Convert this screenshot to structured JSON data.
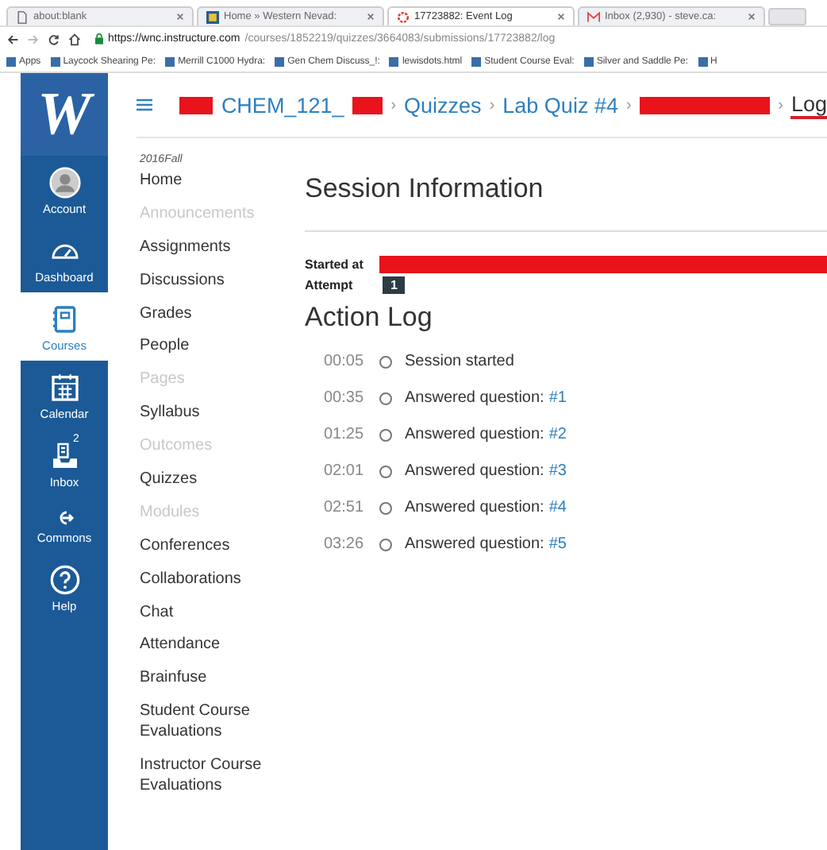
{
  "browser": {
    "tabs": [
      {
        "title": "about:blank",
        "selected": false
      },
      {
        "title": "Home » Western Nevad:",
        "selected": false
      },
      {
        "title": "17723882: Event Log",
        "selected": true
      },
      {
        "title": "Inbox (2,930) - steve.ca:",
        "selected": false
      }
    ],
    "url_host": "https://wnc.instructure.com",
    "url_path": "/courses/1852219/quizzes/3664083/submissions/17723882/log",
    "bookmarks": [
      "Apps",
      "Laycock Shearing Pe:",
      "Merrill C1000 Hydra:",
      "Gen Chem Discuss_!:",
      "lewisdots.html",
      "Student Course Eval:",
      "Silver and Saddle Pe:",
      "H"
    ]
  },
  "logo": "W",
  "global_nav": [
    {
      "label": "Account",
      "selected": false
    },
    {
      "label": "Dashboard",
      "selected": false
    },
    {
      "label": "Courses",
      "selected": true
    },
    {
      "label": "Calendar",
      "selected": false
    },
    {
      "label": "Inbox",
      "selected": false,
      "badge": "2"
    },
    {
      "label": "Commons",
      "selected": false
    },
    {
      "label": "Help",
      "selected": false
    }
  ],
  "breadcrumbs": [
    {
      "kind": "redacted"
    },
    {
      "kind": "text",
      "text": "CHEM_121_"
    },
    {
      "kind": "redacted"
    },
    {
      "kind": "sep",
      "text": "›"
    },
    {
      "kind": "link",
      "text": "Quizzes"
    },
    {
      "kind": "sep",
      "text": "›"
    },
    {
      "kind": "link",
      "text": "Lab Quiz #4"
    },
    {
      "kind": "sep",
      "text": "›"
    },
    {
      "kind": "redacted"
    },
    {
      "kind": "sep",
      "text": "›"
    },
    {
      "kind": "current",
      "text": "Log"
    }
  ],
  "course_nav": {
    "term": "2016Fall",
    "items": [
      {
        "label": "Home",
        "disabled": false
      },
      {
        "label": "Announcements",
        "disabled": true
      },
      {
        "label": "Assignments",
        "disabled": false
      },
      {
        "label": "Discussions",
        "disabled": false
      },
      {
        "label": "Grades",
        "disabled": false
      },
      {
        "label": "People",
        "disabled": false
      },
      {
        "label": "Pages",
        "disabled": true
      },
      {
        "label": "Syllabus",
        "disabled": false
      },
      {
        "label": "Outcomes",
        "disabled": true
      },
      {
        "label": "Quizzes",
        "disabled": false
      },
      {
        "label": "Modules",
        "disabled": true
      },
      {
        "label": "Conferences",
        "disabled": false
      },
      {
        "label": "Collaborations",
        "disabled": false
      },
      {
        "label": "Chat",
        "disabled": false
      },
      {
        "label": "Attendance",
        "disabled": false
      },
      {
        "label": "Brainfuse",
        "disabled": false
      },
      {
        "label": "Student Course Evaluations",
        "disabled": false
      },
      {
        "label": "Instructor Course Evaluations",
        "disabled": false
      }
    ]
  },
  "session": {
    "title": "Session Information",
    "started_label": "Started at",
    "attempt_label": "Attempt",
    "attempt": "1"
  },
  "action_log": {
    "title": "Action Log",
    "entries": [
      {
        "time": "00:05",
        "text": "Session started"
      },
      {
        "time": "00:35",
        "text": "Answered question:",
        "link": "#1"
      },
      {
        "time": "01:25",
        "text": "Answered question:",
        "link": "#2"
      },
      {
        "time": "02:01",
        "text": "Answered question:",
        "link": "#3"
      },
      {
        "time": "02:51",
        "text": "Answered question:",
        "link": "#4"
      },
      {
        "time": "03:26",
        "text": "Answered question:",
        "link": "#5"
      }
    ]
  }
}
